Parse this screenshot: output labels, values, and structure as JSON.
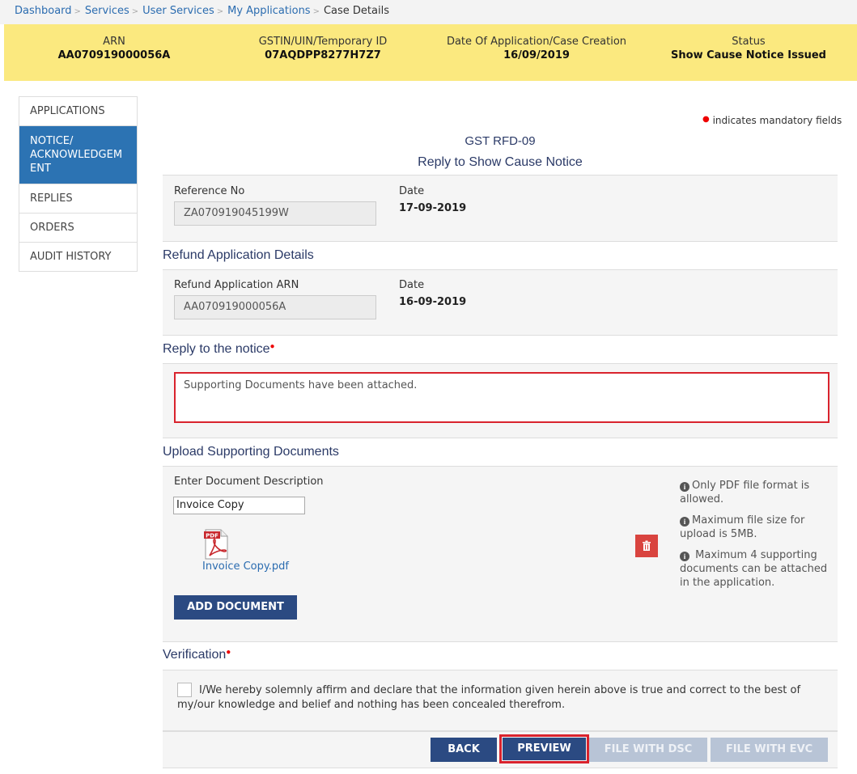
{
  "breadcrumb": {
    "items": [
      "Dashboard",
      "Services",
      "User Services",
      "My Applications"
    ],
    "current": "Case Details"
  },
  "banner": {
    "arn_label": "ARN",
    "arn_value": "AA070919000056A",
    "gstin_label": "GSTIN/UIN/Temporary ID",
    "gstin_value": "07AQDPP8277H7Z7",
    "date_label": "Date Of Application/Case Creation",
    "date_value": "16/09/2019",
    "status_label": "Status",
    "status_value": "Show Cause Notice Issued"
  },
  "sidenav": {
    "items": [
      "APPLICATIONS",
      "NOTICE/ ACKNOWLEDGEM ENT",
      "REPLIES",
      "ORDERS",
      "AUDIT HISTORY"
    ]
  },
  "mandatory_note": "indicates mandatory fields",
  "form": {
    "code": "GST RFD-09",
    "title": "Reply to Show Cause Notice"
  },
  "reference": {
    "ref_label": "Reference No",
    "ref_value": "ZA070919045199W",
    "date_label": "Date",
    "date_value": "17-09-2019"
  },
  "refund": {
    "heading": "Refund Application Details",
    "arn_label": "Refund Application ARN",
    "arn_value": "AA070919000056A",
    "date_label": "Date",
    "date_value": "16-09-2019"
  },
  "reply": {
    "heading": "Reply to the notice",
    "text": "Supporting Documents have been attached."
  },
  "upload": {
    "heading": "Upload Supporting Documents",
    "desc_label": "Enter Document Description",
    "desc_value": "Invoice Copy",
    "file_name": "Invoice Copy.pdf",
    "pdf_badge": "PDF",
    "add_button": "ADD DOCUMENT",
    "info": [
      "Only PDF file format is allowed.",
      "Maximum file size for upload is 5MB.",
      " Maximum 4 supporting documents can be attached in the application."
    ]
  },
  "verification": {
    "heading": "Verification",
    "text": "I/We hereby solemnly affirm and declare that the information given herein above is true and correct to the best of my/our knowledge and belief and nothing has been concealed therefrom."
  },
  "actions": {
    "back": "BACK",
    "preview": "PREVIEW",
    "file_dsc": "FILE WITH DSC",
    "file_evc": "FILE WITH EVC"
  },
  "colors": {
    "banner": "#fbe97f",
    "nav_active": "#2c73b3",
    "primary_button": "#2b4a82",
    "highlight_red": "#d9232d"
  }
}
